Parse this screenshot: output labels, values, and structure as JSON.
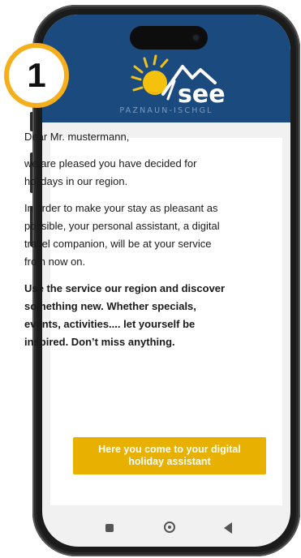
{
  "brand": {
    "logo_word": "see",
    "subtitle": "PAZNAUN-ISCHGL"
  },
  "step": {
    "number": "1"
  },
  "message": {
    "greeting": "Dear Mr. mustermann,",
    "paragraph1": "we are pleased you have decided for holidays in our region.",
    "paragraph2": "In order to make your stay as pleasant as possible, your personal assistant, a digital travel companion, will be at your service from now on.",
    "paragraph3": "Use the service our region and discover something new. Whether specials, events, activities.... let yourself be inspired. Don’t miss anything."
  },
  "cta": {
    "label": "Here you come to your digital holiday assistant"
  },
  "colors": {
    "header": "#1b4a7f",
    "accent": "#e8b000",
    "badge_ring": "#f5ae1c"
  },
  "nav": {
    "icons": [
      "recents-icon",
      "home-icon",
      "back-icon"
    ]
  }
}
